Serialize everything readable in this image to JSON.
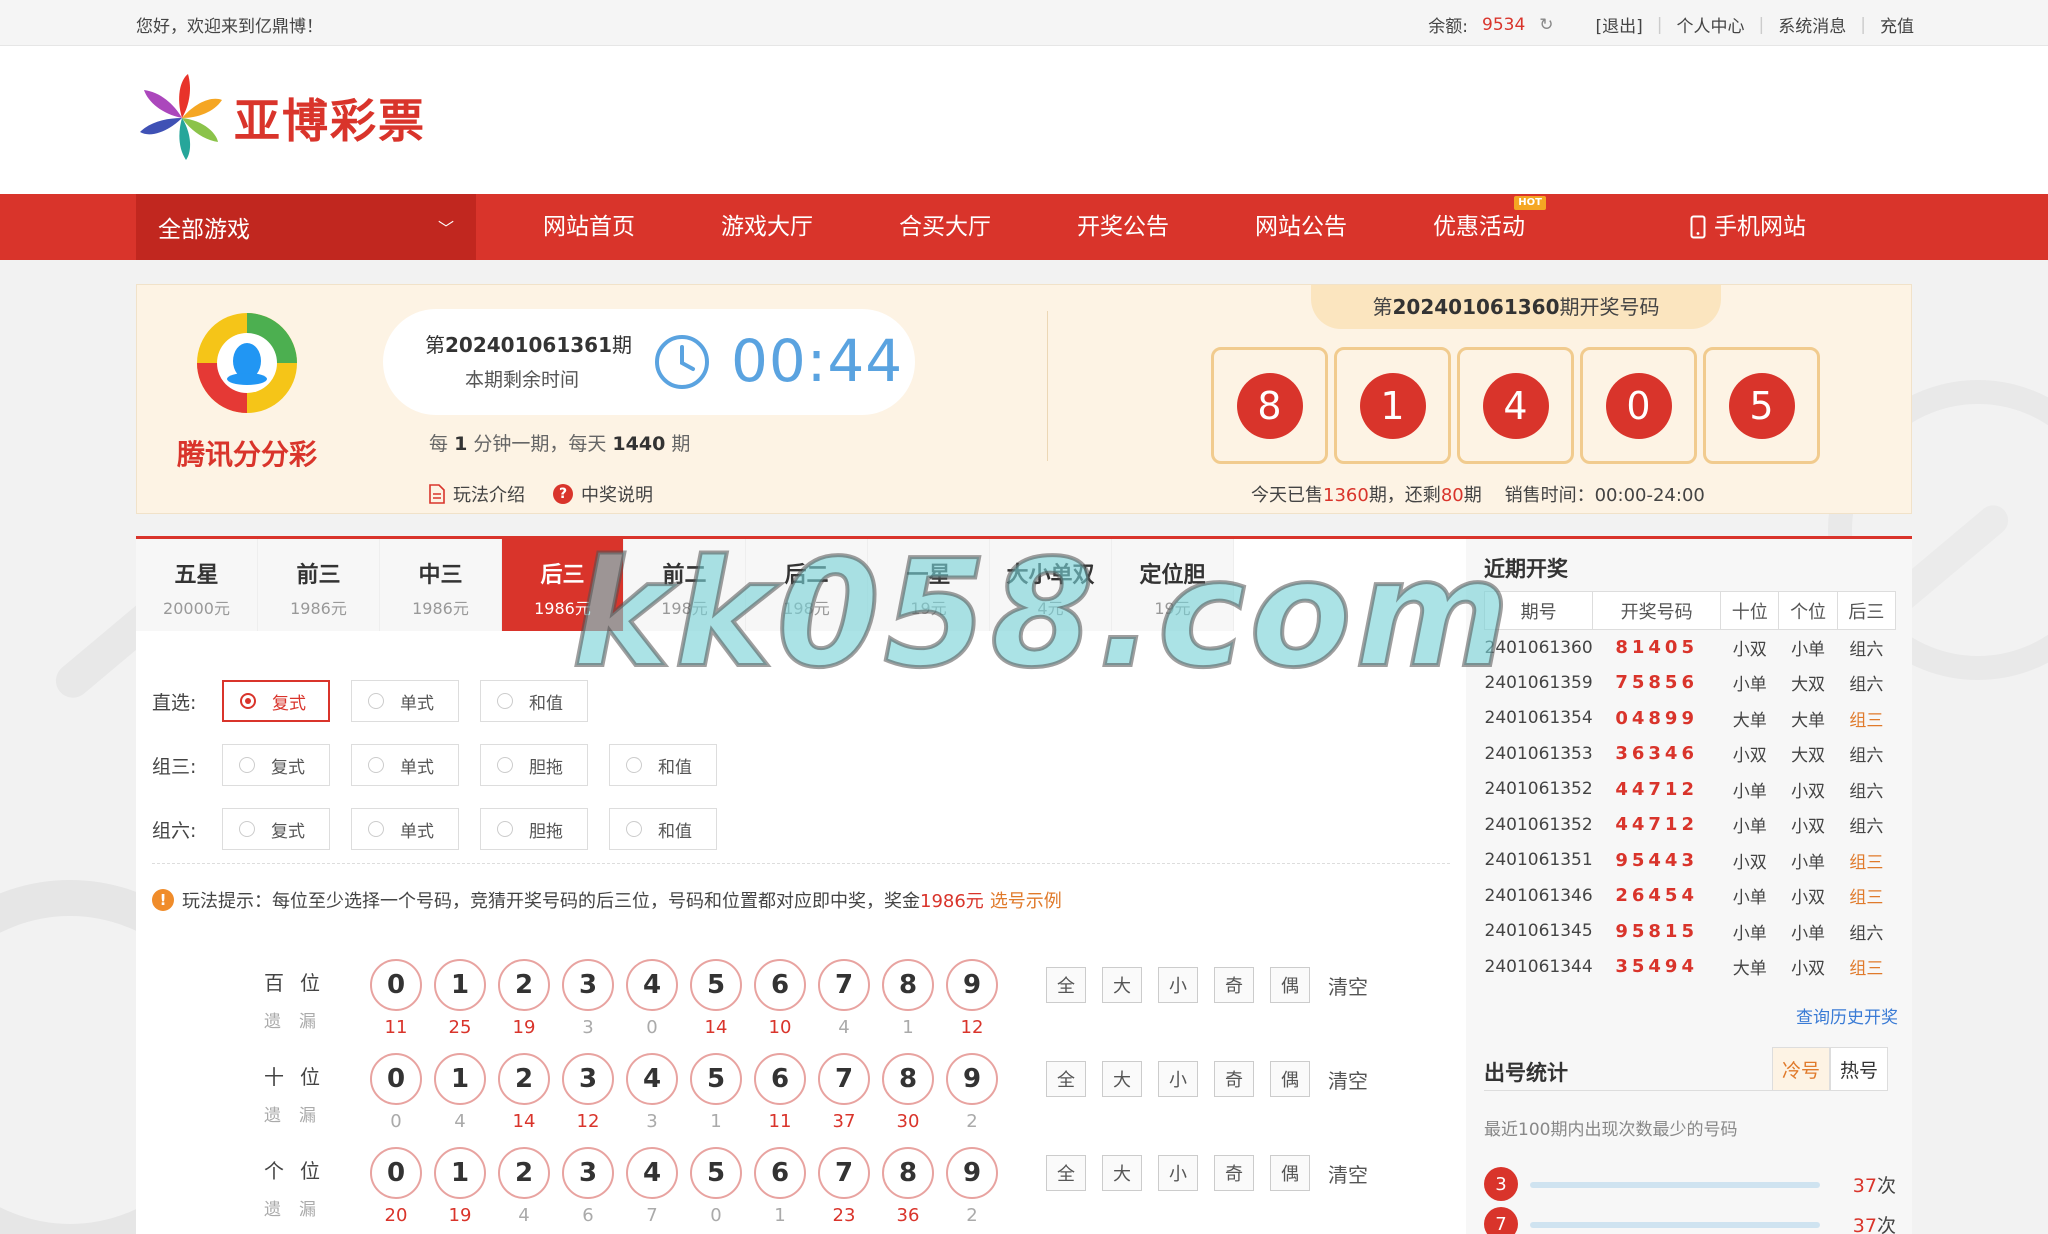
{
  "topbar": {
    "welcome": "您好，欢迎来到亿鼎博！",
    "balance_label": "余额:",
    "balance_value": "9534",
    "logout": "[退出]",
    "user_center": "个人中心",
    "messages": "系统消息",
    "recharge": "充值"
  },
  "logo": {
    "text": "亚博彩票"
  },
  "nav": {
    "all_games": "全部游戏",
    "items": [
      "网站首页",
      "游戏大厅",
      "合买大厅",
      "开奖公告",
      "网站公告",
      "优惠活动"
    ],
    "hot_badge": "HOT",
    "mobile": "手机网站"
  },
  "game": {
    "name": "腾讯分分彩",
    "issue_prefix": "第",
    "issue": "202401061361",
    "issue_suffix": "期",
    "remaining_label": "本期剩余时间",
    "countdown": "00:44",
    "freq_a": "每",
    "freq_minutes": "1",
    "freq_b": "分钟一期，每天",
    "freq_count": "1440",
    "freq_c": "期",
    "rules_link": "玩法介绍",
    "prize_link": "中奖说明",
    "last_issue": "202401061360",
    "last_issue_suffix": "期开奖号码",
    "draw_numbers": [
      "8",
      "1",
      "4",
      "0",
      "5"
    ],
    "sales_a": "今天已售",
    "sales_sold": "1360",
    "sales_b": "期，还剩",
    "sales_left": "80",
    "sales_c": "期",
    "sales_time": "销售时间：00:00-24:00"
  },
  "tabs": [
    {
      "name": "五星",
      "prize": "20000元"
    },
    {
      "name": "前三",
      "prize": "1986元"
    },
    {
      "name": "中三",
      "prize": "1986元"
    },
    {
      "name": "后三",
      "prize": "1986元"
    },
    {
      "name": "前二",
      "prize": "198元"
    },
    {
      "name": "后二",
      "prize": "198元"
    },
    {
      "name": "一星",
      "prize": "19元"
    },
    {
      "name": "大小单双",
      "prize": "4元"
    },
    {
      "name": "定位胆",
      "prize": "19元"
    }
  ],
  "options": {
    "row1": {
      "label": "直选:",
      "items": [
        "复式",
        "单式",
        "和值"
      ]
    },
    "row2": {
      "label": "组三:",
      "items": [
        "复式",
        "单式",
        "胆拖",
        "和值"
      ]
    },
    "row3": {
      "label": "组六:",
      "items": [
        "复式",
        "单式",
        "胆拖",
        "和值"
      ]
    }
  },
  "hint": {
    "text": "玩法提示：每位至少选择一个号码，竞猜开奖号码的后三位，号码和位置都对应即中奖，奖金",
    "amount": "1986元",
    "example": "选号示例"
  },
  "picks": [
    {
      "pos": "百位",
      "miss_label": "遗漏",
      "miss": [
        "11",
        "25",
        "19",
        "3",
        "0",
        "14",
        "10",
        "4",
        "1",
        "12"
      ]
    },
    {
      "pos": "十位",
      "miss_label": "遗漏",
      "miss": [
        "0",
        "4",
        "14",
        "12",
        "3",
        "1",
        "11",
        "37",
        "30",
        "2"
      ]
    },
    {
      "pos": "个位",
      "miss_label": "遗漏",
      "miss": [
        "20",
        "19",
        "4",
        "6",
        "7",
        "0",
        "1",
        "23",
        "36",
        "2"
      ]
    }
  ],
  "digits": [
    "0",
    "1",
    "2",
    "3",
    "4",
    "5",
    "6",
    "7",
    "8",
    "9"
  ],
  "quick": [
    "全",
    "大",
    "小",
    "奇",
    "偶"
  ],
  "quick_clear": "清空",
  "recent": {
    "title": "近期开奖",
    "headers": [
      "期号",
      "开奖号码",
      "十位",
      "个位",
      "后三"
    ],
    "rows": [
      [
        "2401061360",
        "81405",
        "小双",
        "小单",
        "组六"
      ],
      [
        "2401061359",
        "75856",
        "小单",
        "大双",
        "组六"
      ],
      [
        "2401061354",
        "04899",
        "大单",
        "大单",
        "组三"
      ],
      [
        "2401061353",
        "36346",
        "小双",
        "大双",
        "组六"
      ],
      [
        "2401061352",
        "44712",
        "小单",
        "小双",
        "组六"
      ],
      [
        "2401061352",
        "44712",
        "小单",
        "小双",
        "组六"
      ],
      [
        "2401061351",
        "95443",
        "小双",
        "小单",
        "组三"
      ],
      [
        "2401061346",
        "26454",
        "小单",
        "小双",
        "组三"
      ],
      [
        "2401061345",
        "95815",
        "小单",
        "小单",
        "组六"
      ],
      [
        "2401061344",
        "35494",
        "大单",
        "小双",
        "组三"
      ]
    ],
    "history_link": "查询历史开奖"
  },
  "stats": {
    "title": "出号统计",
    "tab_cold": "冷号",
    "tab_hot": "热号",
    "desc": "最近100期内出现次数最少的号码",
    "items": [
      {
        "num": "3",
        "count": "37",
        "unit": "次"
      },
      {
        "num": "7",
        "count": "37",
        "unit": "次"
      }
    ]
  },
  "watermark": "kk058.com",
  "colors": {
    "brand_red": "#d9342b",
    "accent_orange": "#e07a2b",
    "countdown_blue": "#5aa3e0",
    "panel_cream": "#fdf3e4"
  }
}
